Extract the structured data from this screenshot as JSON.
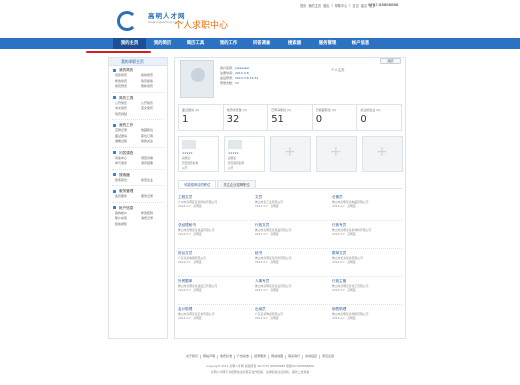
{
  "header": {
    "brand": "高明人才网",
    "site": "www.rcgaoming.com.cn",
    "title": "个人求职中心",
    "top_links": [
      "首页",
      "我的主页",
      "退出",
      "|",
      "帮助中心",
      "|",
      "意见",
      "建议",
      "更多"
    ],
    "hotline": "0757-88888888"
  },
  "nav": {
    "items": [
      "我的主页",
      "我的简历",
      "简历工具",
      "我的工作",
      "问答调查",
      "搜索器",
      "服务管理",
      "帐户信息"
    ],
    "active_index": 0
  },
  "sidebar": {
    "title": "我的求职主页",
    "sections": [
      {
        "heading": "我的简历",
        "links": [
          "创建简历",
          "我的简历",
          "修改简历",
          "简历模版",
          "简历预览",
          "刷新简历"
        ]
      },
      {
        "heading": "简历工具",
        "links": [
          "公开简历",
          "公开简历",
          "中文简历",
          "英文简历",
          "简历视频",
          ""
        ]
      },
      {
        "heading": "我的工作",
        "links": [
          "应聘记录",
          "收藏职位",
          "面试邀请",
          "职位订阅",
          "谁看过我",
          "我的关注"
        ]
      },
      {
        "heading": "问答调查",
        "links": [
          "问答中心",
          "调查问卷",
          "参与测评",
          "测评结果"
        ]
      },
      {
        "heading": "搜索器",
        "links": [
          "搜索职位",
          "搜索企业"
        ]
      },
      {
        "heading": "服务管理",
        "links": [
          "会员服务",
          "服务记录"
        ]
      },
      {
        "heading": "帐户信息",
        "links": [
          "我的帐户",
          "修改密码",
          "账户充值",
          "消费记录",
          "短信通知",
          ""
        ]
      }
    ]
  },
  "profile": {
    "lines": [
      {
        "label": "用户名称：",
        "value": "jobseeker"
      },
      {
        "label": "注册时间：",
        "value": "2014-3-8"
      },
      {
        "label": "最后登录：",
        "value": "2014-3-8 14:32"
      },
      {
        "label": "登录次数：",
        "value": "12"
      }
    ],
    "resume_link": "个人主页",
    "resume_button": "简历"
  },
  "stats": [
    {
      "label": "面试邀请 (0)",
      "value": "1"
    },
    {
      "label": "简历浏览量 (0)",
      "value": "32"
    },
    {
      "label": "已申请职位 (0)",
      "value": "51"
    },
    {
      "label": "已收藏职位 (0)",
      "value": "0"
    },
    {
      "label": "关注的企业 (0)",
      "value": "0"
    }
  ],
  "cards": [
    {
      "name": "暂无简历名称",
      "level": "完整度",
      "stars": "★★★★★",
      "status": "公开"
    },
    {
      "name": "暂无简历名称",
      "level": "完整度",
      "stars": "★★★★★",
      "status": "公开"
    }
  ],
  "tabs": [
    "可能想申请的职位",
    "关注企业招聘职位"
  ],
  "jobs": [
    {
      "title": "工程文员",
      "company": "广州市高明区某某科技有限公司",
      "date": "2014-3-7",
      "loc": "高明区"
    },
    {
      "title": "文员",
      "company": "佛山市某工业有限公司",
      "date": "2014-3-7",
      "loc": "高明区"
    },
    {
      "title": "仓管员",
      "company": "佛山市高明某某制品有限公司",
      "date": "2014-3-7",
      "loc": "高明区"
    },
    {
      "title": "总经理秘书",
      "company": "佛山市高明某某食品有限公司",
      "date": "2014-3-7",
      "loc": "高明区"
    },
    {
      "title": "行政文员",
      "company": "佛山市高明某某纸品有限公司",
      "date": "2014-3-7",
      "loc": "高明区"
    },
    {
      "title": "行政专员",
      "company": "佛山市高明某某新材料有限公司",
      "date": "2014-3-7",
      "loc": "高明区"
    },
    {
      "title": "前台文员",
      "company": "广东某某电器有限公司",
      "date": "2014-3-7",
      "loc": "高明区"
    },
    {
      "title": "秘书",
      "company": "佛山市高明某某印务有限公司",
      "date": "2014-3-7",
      "loc": "高明区"
    },
    {
      "title": "跟单文员",
      "company": "佛山市某某家具有限公司",
      "date": "2014-3-7",
      "loc": "高明区"
    },
    {
      "title": "外贸跟单",
      "company": "佛山市高明某某进出口有限公司",
      "date": "2014-3-7",
      "loc": "高明区"
    },
    {
      "title": "人事专员",
      "company": "佛山市高明某某实业有限公司",
      "date": "2014-3-7",
      "loc": "高明区"
    },
    {
      "title": "行政主管",
      "company": "佛山市高明某某化工有限公司",
      "date": "2014-3-7",
      "loc": "高明区"
    },
    {
      "title": "会计助理",
      "company": "佛山市高明某某五金有限公司",
      "date": "2014-3-7",
      "loc": "高明区"
    },
    {
      "title": "出纳员",
      "company": "广东某某陶瓷有限公司",
      "date": "2014-3-7",
      "loc": "高明区"
    },
    {
      "title": "销售助理",
      "company": "佛山市高明某某塑料有限公司",
      "date": "2014-3-7",
      "loc": "高明区"
    }
  ],
  "footer": {
    "links": [
      "关于我们",
      "网站声明",
      "收费标准",
      "广告投放",
      "招聘服务",
      "网站地图",
      "联系我们",
      "友情链接",
      "意见反馈"
    ],
    "copyright": "Copyright 2014 高明人才网 版权所有 Tel:0757-88888888 客服QQ:888888888",
    "notice": "高明人才网不对招聘信息的真实性作担保，请求职者注意辨别，谨防上当受骗"
  }
}
